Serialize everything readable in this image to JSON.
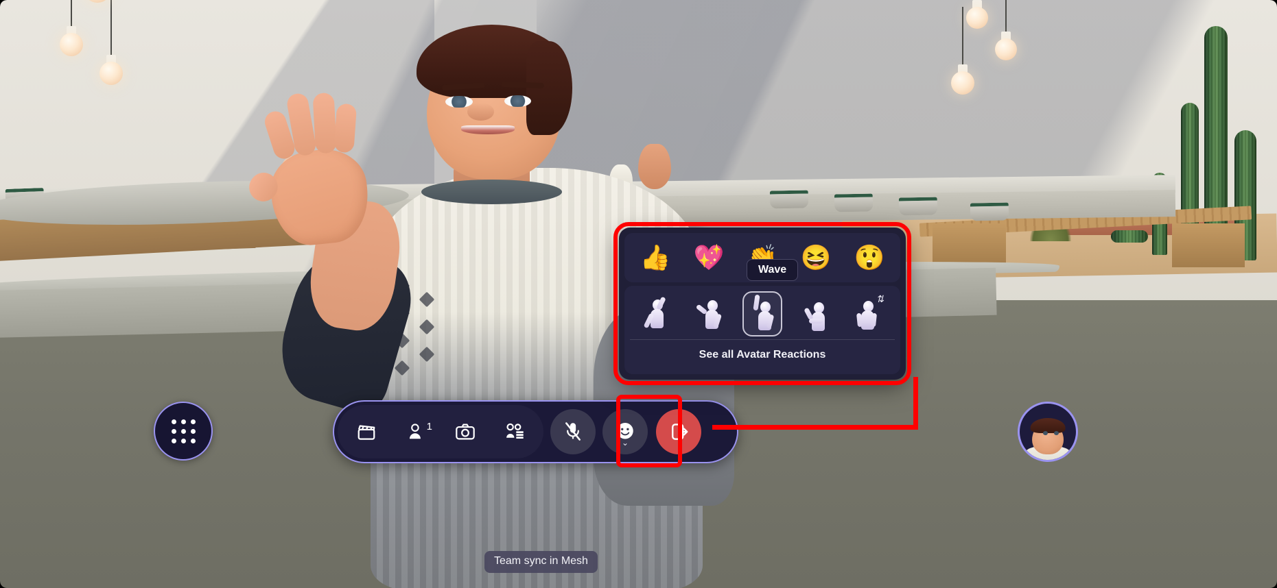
{
  "app": {
    "title": "Team sync in Mesh",
    "meeting_tooltip": "Team sync in Mesh"
  },
  "colors": {
    "annotation_red": "#ff0000",
    "accent_purple": "#9a93f0",
    "toolbar_bg": "#1b1938",
    "panel_bg": "#201f37",
    "panel_row_bg": "#262542",
    "leave_red": "#d44b4b"
  },
  "app_launcher": {
    "name": "grid-dots-icon",
    "label": ""
  },
  "toolbar": {
    "buttons": [
      {
        "name": "content-button",
        "icon": "clapperboard-icon",
        "label": "",
        "badge": ""
      },
      {
        "name": "people-button",
        "icon": "person-icon",
        "label": "",
        "badge": "1"
      },
      {
        "name": "camera-button",
        "icon": "camera-icon",
        "label": "",
        "badge": ""
      },
      {
        "name": "avatar-settings-button",
        "icon": "avatar-list-icon",
        "label": "",
        "badge": ""
      }
    ],
    "mic": {
      "name": "mic-muted-button",
      "icon": "microphone-muted-icon",
      "label": "",
      "state": "muted"
    },
    "reactions": {
      "name": "reactions-button",
      "icon": "smiley-icon",
      "label": "",
      "chevron": "⌄"
    },
    "leave": {
      "name": "leave-button",
      "icon": "leave-call-icon",
      "label": ""
    }
  },
  "self_view": {
    "name": "self-avatar-thumbnail",
    "label": ""
  },
  "reactions_panel": {
    "emoji": [
      {
        "name": "reaction-thumbs-up",
        "glyph": "👍",
        "label": "Like"
      },
      {
        "name": "reaction-heart",
        "glyph": "💖",
        "label": "Heart"
      },
      {
        "name": "reaction-applause",
        "glyph": "👏",
        "label": "Applause"
      },
      {
        "name": "reaction-laugh",
        "glyph": "😆",
        "label": "Laugh"
      },
      {
        "name": "reaction-surprised",
        "glyph": "😲",
        "label": "Surprised"
      }
    ],
    "tooltip": {
      "text": "Wave",
      "for": "reaction-applause"
    },
    "gestures": [
      {
        "name": "gesture-celebrate",
        "label": "Celebrate",
        "selected": false,
        "badge": ""
      },
      {
        "name": "gesture-salute",
        "label": "Salute",
        "selected": false,
        "badge": ""
      },
      {
        "name": "gesture-raise-hand",
        "label": "Raise hand",
        "selected": true,
        "badge": ""
      },
      {
        "name": "gesture-talk",
        "label": "Talk",
        "selected": false,
        "badge": ""
      },
      {
        "name": "gesture-sit-stand",
        "label": "Sit or stand",
        "selected": false,
        "badge": "⇅"
      }
    ],
    "see_all": "See all Avatar Reactions"
  }
}
